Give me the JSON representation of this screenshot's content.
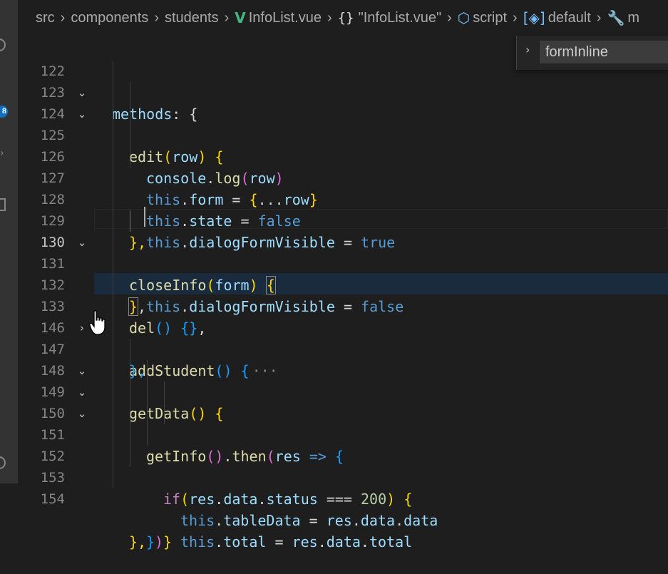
{
  "breadcrumb": {
    "items": [
      "src",
      "components",
      "students",
      "InfoList.vue",
      "\"InfoList.vue\"",
      "script",
      "default",
      "m"
    ]
  },
  "find_widget": {
    "value": "formInline"
  },
  "activity_badge": "8",
  "lines": [
    {
      "num": "122",
      "fold": "⌄"
    },
    {
      "num": "123",
      "fold": "⌄"
    },
    {
      "num": "124",
      "fold": ""
    },
    {
      "num": "125",
      "fold": ""
    },
    {
      "num": "126",
      "fold": ""
    },
    {
      "num": "127",
      "fold": ""
    },
    {
      "num": "128",
      "fold": ""
    },
    {
      "num": "129",
      "fold": "⌄"
    },
    {
      "num": "130",
      "fold": ""
    },
    {
      "num": "131",
      "fold": ""
    },
    {
      "num": "132",
      "fold": ""
    },
    {
      "num": "133",
      "fold": "›"
    },
    {
      "num": "146",
      "fold": ""
    },
    {
      "num": "147",
      "fold": "⌄"
    },
    {
      "num": "148",
      "fold": "⌄"
    },
    {
      "num": "149",
      "fold": "⌄"
    },
    {
      "num": "150",
      "fold": ""
    },
    {
      "num": "151",
      "fold": ""
    },
    {
      "num": "152",
      "fold": ""
    },
    {
      "num": "153",
      "fold": ""
    },
    {
      "num": "154",
      "fold": ""
    }
  ],
  "tokens": {
    "l122": [
      "methods",
      ": {"
    ],
    "l123": [
      "edit",
      "(",
      "row",
      ") {"
    ],
    "l124": [
      "console",
      ".",
      "log",
      "(",
      "row",
      ")"
    ],
    "l125": [
      "this",
      ".",
      "form",
      " = ",
      "{",
      "...",
      "row",
      "}"
    ],
    "l126": [
      "this",
      ".",
      "state",
      " = ",
      "false"
    ],
    "l127": [
      "this",
      ".",
      "dialogFormVisible",
      " = ",
      "true"
    ],
    "l128": [
      "},"
    ],
    "l129": [
      "closeInfo",
      "(",
      "form",
      ") ",
      "{"
    ],
    "l130": [
      "this",
      ".",
      "dialogFormVisible",
      " = ",
      "false"
    ],
    "l131": [
      "}",
      ","
    ],
    "l132": [
      "del",
      "() ",
      "{}",
      ","
    ],
    "l133": [
      "addStudent",
      "() ",
      "{",
      "···"
    ],
    "l146": [
      "},"
    ],
    "l147": [
      "getData",
      "() {"
    ],
    "l148": [
      "getInfo",
      "()",
      ".",
      "then",
      "(",
      "res",
      " => ",
      "{"
    ],
    "l149": [
      "if",
      "(",
      "res",
      ".",
      "data",
      ".",
      "status",
      " === ",
      "200",
      ") ",
      "{"
    ],
    "l150": [
      "this",
      ".",
      "tableData",
      " = ",
      "res",
      ".",
      "data",
      ".",
      "data"
    ],
    "l151": [
      "this",
      ".",
      "total",
      " = ",
      "res",
      ".",
      "data",
      ".",
      "total"
    ],
    "l152": [
      "}"
    ],
    "l153": [
      "}",
      ")"
    ],
    "l154": [
      "},"
    ]
  }
}
